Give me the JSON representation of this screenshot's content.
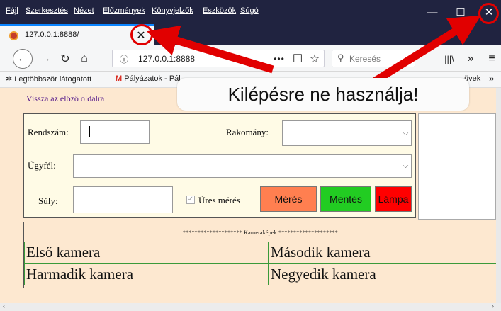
{
  "browser": {
    "menu": [
      "Fájl",
      "Szerkesztés",
      "Nézet",
      "Előzmények",
      "Könyvjelzők",
      "Eszközök",
      "Súgó"
    ],
    "window_buttons": {
      "minimize": "—",
      "maximize": "☐",
      "close": "✕"
    },
    "tab": {
      "title": "127.0.0.1:8888/",
      "close": "✕"
    },
    "new_tab": "+",
    "url": "127.0.0.1:8888",
    "url_info_icon": "ⓘ",
    "search_placeholder": "Keresés",
    "page_actions": "•••",
    "bookmarks": [
      {
        "label": "Legtöbbször látogatott",
        "icon": "gear-icon"
      },
      {
        "label": "Pályázatok - Pál",
        "icon": "gmail-icon"
      },
      {
        "label": "üvek",
        "icon": ""
      }
    ],
    "bookmarks_overflow": "»"
  },
  "page": {
    "back_link": "Vissza az előző oldalra",
    "form": {
      "plate_label": "Rendszám:",
      "plate_value": "",
      "cargo_label": "Rakomány:",
      "client_label": "Ügyfél:",
      "weight_label": "Súly:",
      "empty_measure_label": "Üres mérés",
      "empty_measure_checked": true,
      "measure_button": "Mérés",
      "save_button": "Mentés",
      "lamp_button": "Lámpa"
    },
    "cameras": {
      "header": "******************** Kameraképek ********************",
      "cells": [
        "Első kamera",
        "Második kamera",
        "Harmadik kamera",
        "Negyedik kamera"
      ]
    }
  },
  "annotation": {
    "callout": "Kilépésre ne használja!"
  },
  "colors": {
    "titlebar": "#202340",
    "page_bg": "#fde8d0",
    "form_bg": "#fffbe6",
    "measure_btn": "#ff7f50",
    "save_btn": "#22cc22",
    "lamp_btn": "#ff0000",
    "annotation_red": "#e10000"
  }
}
